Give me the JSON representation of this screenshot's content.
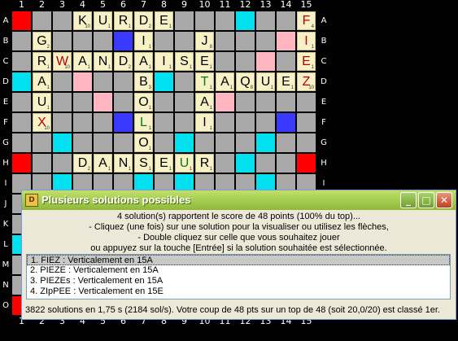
{
  "board": {
    "columns": [
      "1",
      "2",
      "3",
      "4",
      "5",
      "6",
      "7",
      "8",
      "9",
      "10",
      "11",
      "12",
      "13",
      "14",
      "15"
    ],
    "rows": [
      "A",
      "B",
      "C",
      "D",
      "E",
      "F",
      "G",
      "H",
      "I",
      "J",
      "K",
      "L",
      "M",
      "N",
      "O"
    ],
    "tiles": [
      {
        "r": 0,
        "c": 3,
        "l": "K",
        "p": "10"
      },
      {
        "r": 0,
        "c": 4,
        "l": "U",
        "p": "1"
      },
      {
        "r": 0,
        "c": 5,
        "l": "R",
        "p": "1"
      },
      {
        "r": 0,
        "c": 6,
        "l": "D",
        "p": "2"
      },
      {
        "r": 0,
        "c": 7,
        "l": "E",
        "p": "1"
      },
      {
        "r": 0,
        "c": 14,
        "l": "F",
        "p": "4",
        "cls": "r"
      },
      {
        "r": 1,
        "c": 1,
        "l": "G",
        "p": "2"
      },
      {
        "r": 1,
        "c": 6,
        "l": "I",
        "p": "1"
      },
      {
        "r": 1,
        "c": 9,
        "l": "J",
        "p": "8"
      },
      {
        "r": 1,
        "c": 14,
        "l": "I",
        "p": "1",
        "cls": "r"
      },
      {
        "r": 2,
        "c": 1,
        "l": "R",
        "p": "1"
      },
      {
        "r": 2,
        "c": 2,
        "l": "W",
        "p": "10",
        "cls": "r"
      },
      {
        "r": 2,
        "c": 3,
        "l": "A",
        "p": "1"
      },
      {
        "r": 2,
        "c": 4,
        "l": "N",
        "p": "1"
      },
      {
        "r": 2,
        "c": 5,
        "l": "D",
        "p": "2"
      },
      {
        "r": 2,
        "c": 6,
        "l": "A",
        "p": "1"
      },
      {
        "r": 2,
        "c": 7,
        "l": "I",
        "p": "1"
      },
      {
        "r": 2,
        "c": 8,
        "l": "S",
        "p": "1"
      },
      {
        "r": 2,
        "c": 9,
        "l": "E",
        "p": "1"
      },
      {
        "r": 2,
        "c": 14,
        "l": "E",
        "p": "1",
        "cls": "r"
      },
      {
        "r": 3,
        "c": 1,
        "l": "A",
        "p": "1"
      },
      {
        "r": 3,
        "c": 6,
        "l": "B",
        "p": "3"
      },
      {
        "r": 3,
        "c": 9,
        "l": "T",
        "p": "1",
        "cls": "g"
      },
      {
        "r": 3,
        "c": 10,
        "l": "A",
        "p": "1"
      },
      {
        "r": 3,
        "c": 11,
        "l": "Q",
        "p": "8"
      },
      {
        "r": 3,
        "c": 12,
        "l": "U",
        "p": "1"
      },
      {
        "r": 3,
        "c": 13,
        "l": "E",
        "p": "1"
      },
      {
        "r": 3,
        "c": 14,
        "l": "Z",
        "p": "10",
        "cls": "r"
      },
      {
        "r": 4,
        "c": 1,
        "l": "U",
        "p": "1"
      },
      {
        "r": 4,
        "c": 6,
        "l": "O",
        "p": "1"
      },
      {
        "r": 4,
        "c": 9,
        "l": "A",
        "p": "1"
      },
      {
        "r": 5,
        "c": 1,
        "l": "X",
        "p": "10",
        "cls": "r"
      },
      {
        "r": 5,
        "c": 6,
        "l": "L",
        "p": "1",
        "cls": "g"
      },
      {
        "r": 5,
        "c": 9,
        "l": "I",
        "p": "1"
      },
      {
        "r": 6,
        "c": 6,
        "l": "O",
        "p": "1"
      },
      {
        "r": 7,
        "c": 3,
        "l": "D",
        "p": "2"
      },
      {
        "r": 7,
        "c": 4,
        "l": "A",
        "p": "1"
      },
      {
        "r": 7,
        "c": 5,
        "l": "N",
        "p": "1"
      },
      {
        "r": 7,
        "c": 6,
        "l": "S",
        "p": "1"
      },
      {
        "r": 7,
        "c": 7,
        "l": "E",
        "p": "1"
      },
      {
        "r": 7,
        "c": 8,
        "l": "U",
        "p": "1",
        "cls": "g"
      },
      {
        "r": 7,
        "c": 9,
        "l": "R",
        "p": "1"
      }
    ],
    "colors": {
      "grey": "#a8a8a8",
      "red": "#ff0000",
      "pink": "#ffb6c1",
      "cyan": "#00e0ef",
      "blue": "#3a3aff"
    }
  },
  "dialog": {
    "title": "Plusieurs solutions possibles",
    "icon": "app-icon",
    "message_lines": [
      "4 solution(s) rapportent le score de 48 points (100% du top)...",
      "- Cliquez (une fois) sur une solution pour la visualiser ou utilisez les flèches,",
      "- Double cliquez sur celle que vous souhaitez jouer",
      "ou appuyez sur la touche [Entrée] si la solution souhaitée est sélectionnée."
    ],
    "solutions": [
      "1. FIEZ : Verticalement en 15A",
      "2. PIEZE : Verticalement en 15A",
      "3. PIEZEs : Verticalement en 15A",
      "4. ZIpPEE : Verticalement en 15E"
    ],
    "status": "3822 solutions en 1,75 s (2184 sol/s). Votre coup de 48 pts sur un top de 48 (soit 20,0/20) est classé 1er.",
    "buttons": {
      "minimize": "_",
      "maximize": "□",
      "close": "✕"
    }
  }
}
